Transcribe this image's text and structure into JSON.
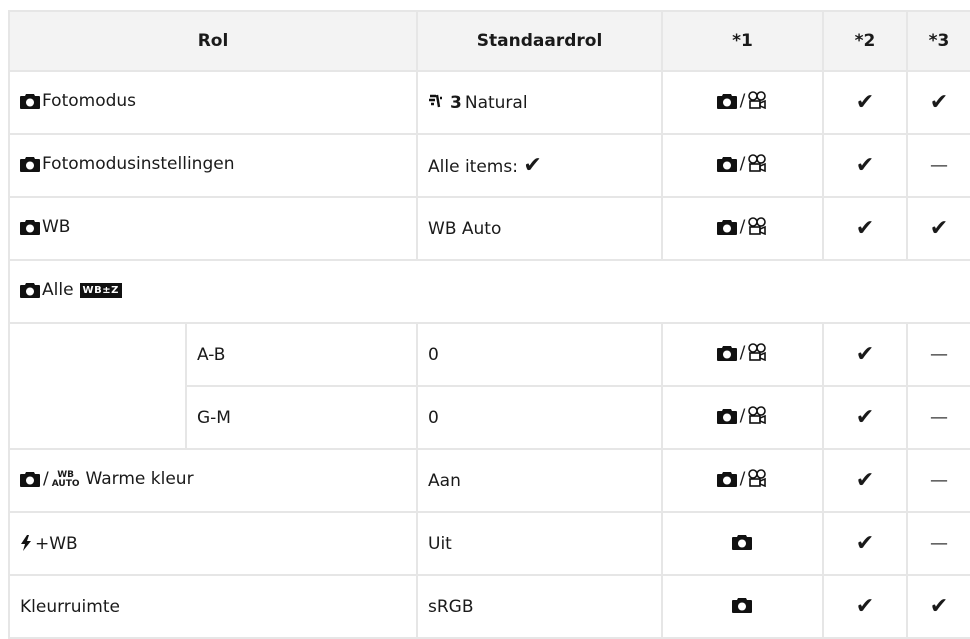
{
  "headers": [
    "Rol",
    "Standaardrol",
    "*1",
    "*2",
    "*3"
  ],
  "symbols": {
    "check": "✔",
    "dash": "—",
    "slash": "/"
  },
  "rows": {
    "r1": {
      "label": "Fotomodus",
      "default_prefix": "3",
      "default": "Natural"
    },
    "r2": {
      "label": "Fotomodusinstellingen",
      "default": "Alle items:"
    },
    "r3": {
      "label": "WB",
      "default": "WB Auto"
    },
    "r4": {
      "label": "Alle",
      "badge": "WB±Z"
    },
    "r5": {
      "sub": "A-B",
      "default": "0"
    },
    "r6": {
      "sub": "G-M",
      "default": "0"
    },
    "r7": {
      "label": "Warme kleur",
      "wb_top": "WB",
      "wb_bottom": "AUTO",
      "default": "Aan"
    },
    "r8": {
      "label": "+WB",
      "default": "Uit"
    },
    "r9": {
      "label": "Kleurruimte",
      "default": "sRGB"
    }
  },
  "icons": [
    "camera-icon",
    "movie-icon",
    "picture-mode-icon",
    "flash-icon",
    "wb-compensation-icon",
    "wb-auto-icon",
    "check-icon",
    "dash-icon"
  ]
}
